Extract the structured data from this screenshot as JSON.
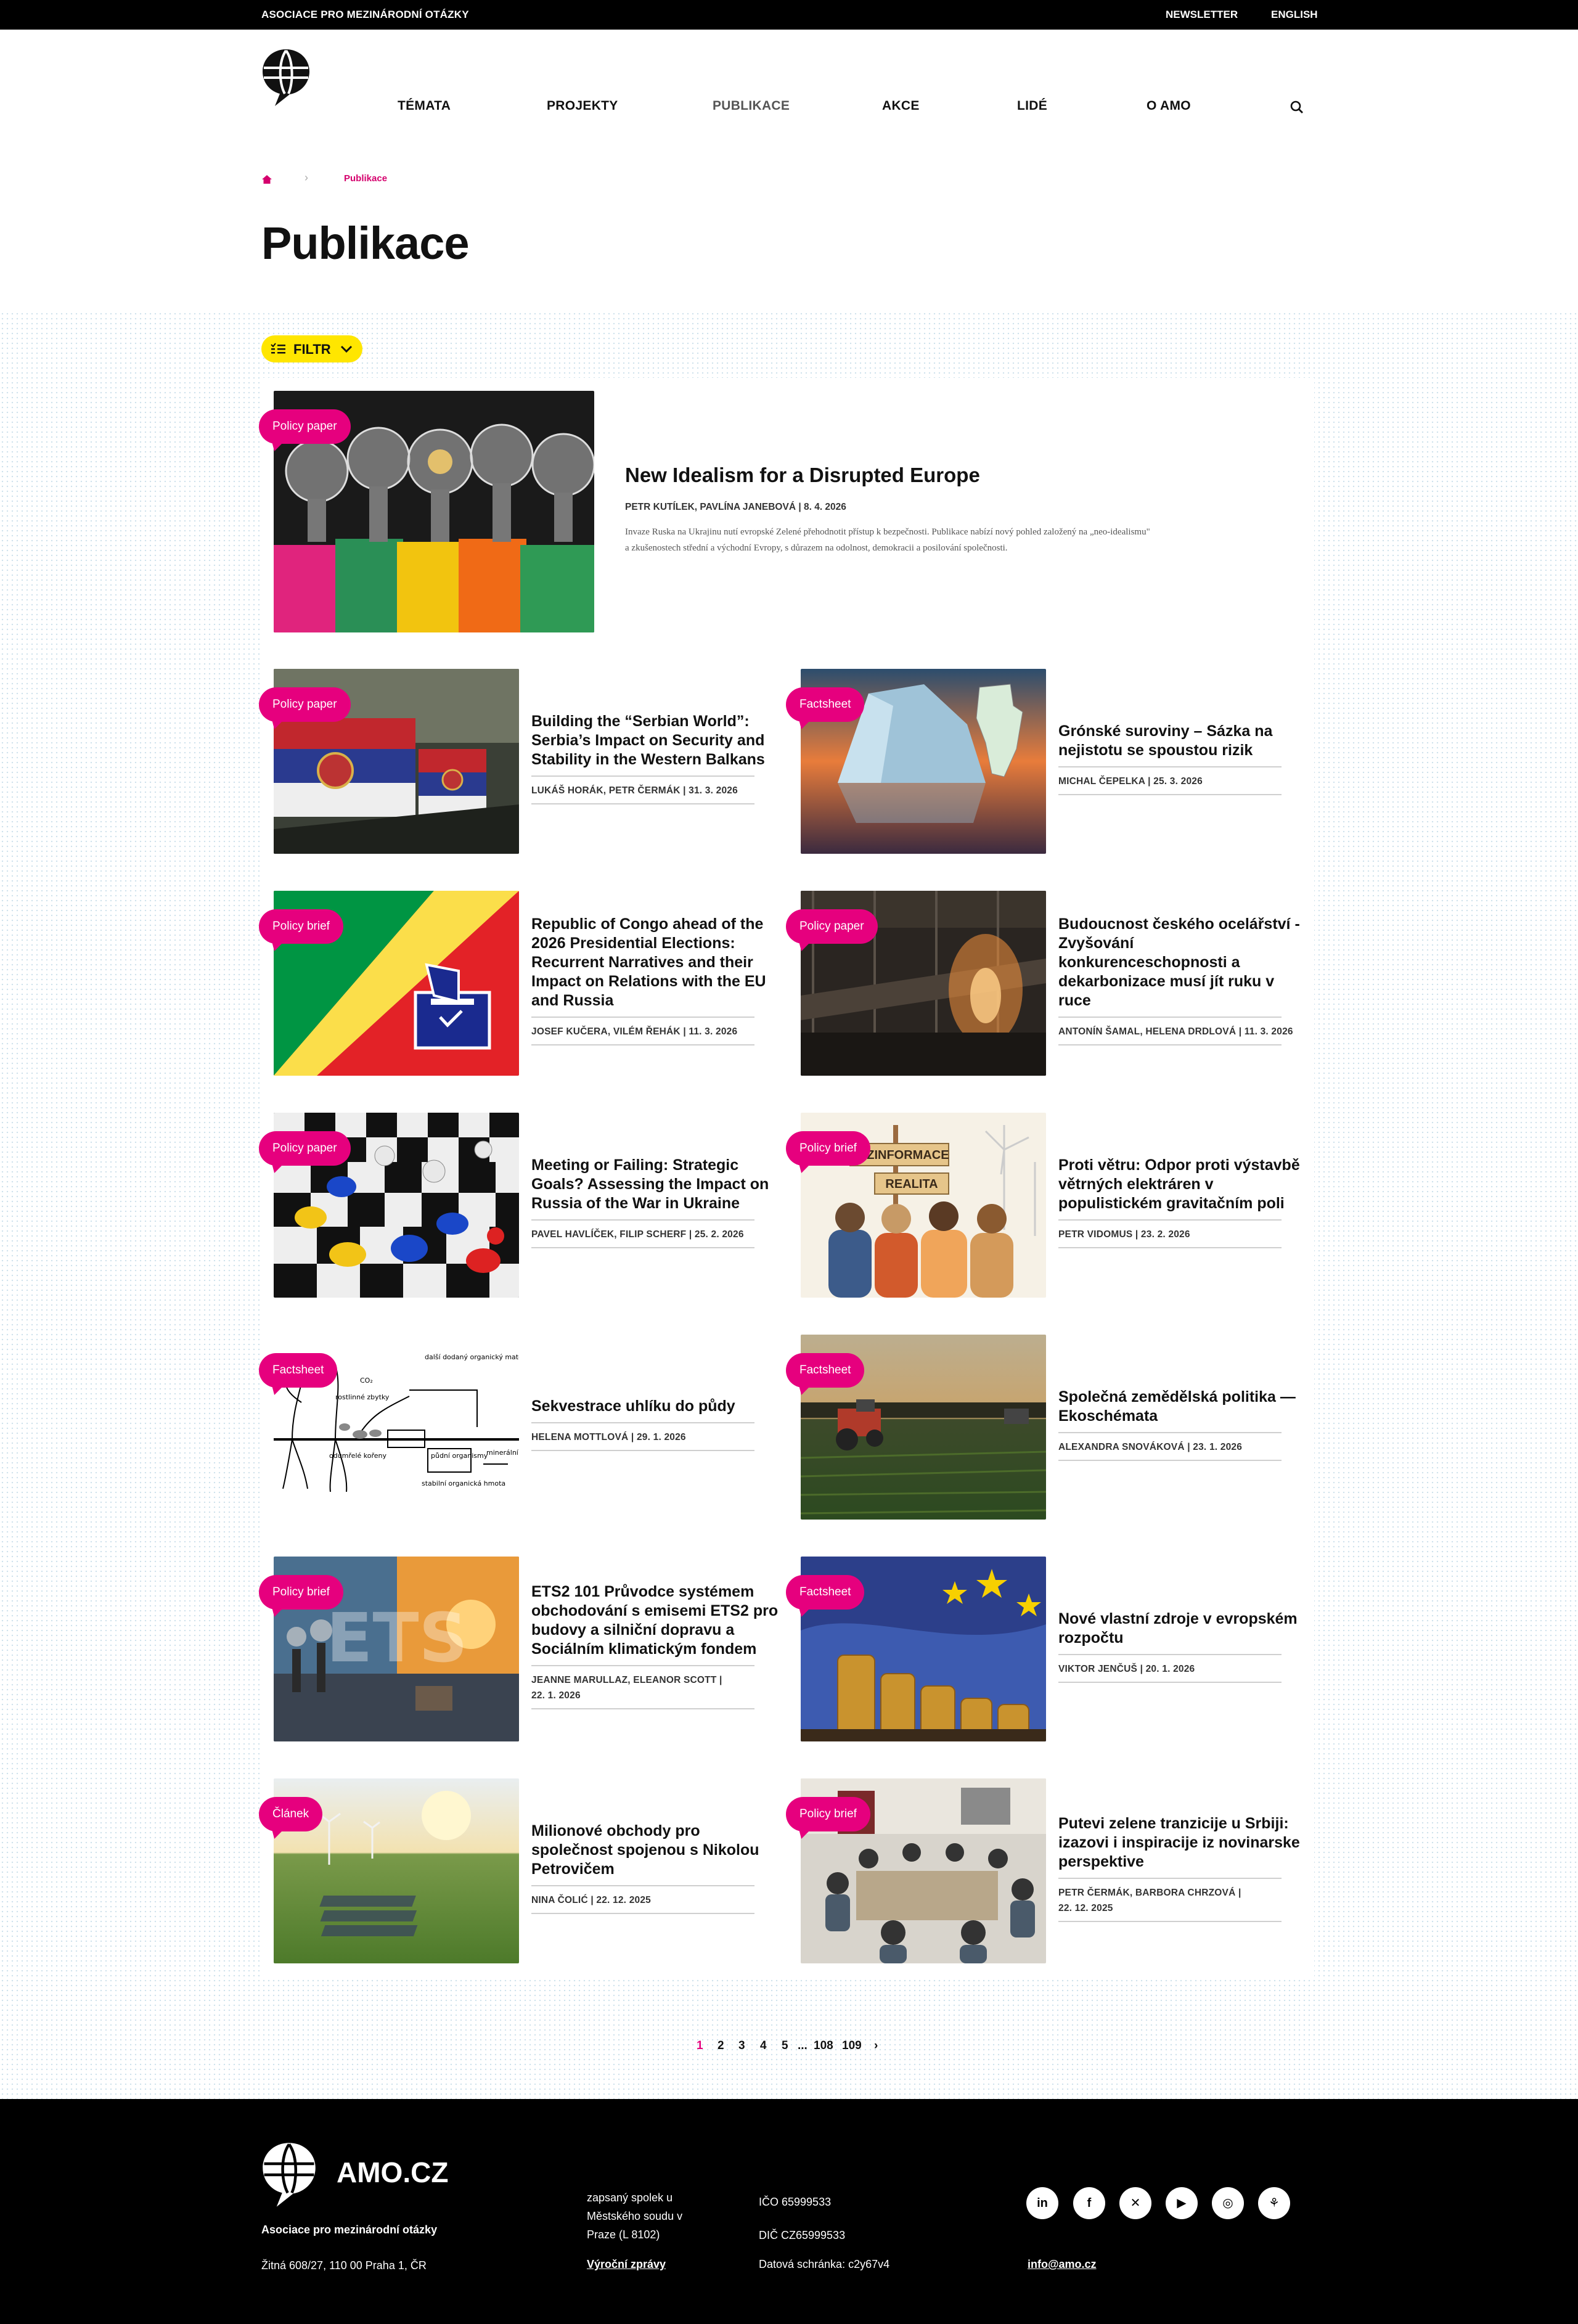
{
  "topbar": {
    "org": "ASOCIACE PRO MEZINÁRODNÍ OTÁZKY",
    "newsletter": "NEWSLETTER",
    "english": "ENGLISH"
  },
  "nav": {
    "items": [
      "TÉMATA",
      "PROJEKTY",
      "PUBLIKACE",
      "AKCE",
      "LIDÉ",
      "O AMO"
    ],
    "active": "PUBLIKACE",
    "search_icon": "search-icon"
  },
  "breadcrumb": {
    "home_icon": "home-icon",
    "current": "Publikace"
  },
  "page_title": "Publikace",
  "filter": {
    "label": "FILTR",
    "icon": "filter-list-icon",
    "chevron": "chevron-down-icon"
  },
  "featured": {
    "tag": "Policy paper",
    "title": "New Idealism for a Disrupted Europe",
    "meta": "PETR KUTÍLEK, PAVLÍNA JANEBOVÁ | 8. 4. 2026",
    "excerpt_1": "Invaze Ruska na Ukrajinu nutí evropské Zelené přehodnotit přístup k bezpečnosti. Publikace nabízí nový pohled založený na „neo-idealismu\"",
    "excerpt_2": "a zkušenostech střední a východní Evropy, s důrazem na odolnost, demokracii a posilování společnosti."
  },
  "cards": [
    {
      "tag": "Policy paper",
      "title_lines": [
        "Building the “Serbian World”:",
        "Serbia’s Impact on Security and",
        "Stability in the Western Balkans"
      ],
      "meta_lines": [
        "LUKÁŠ HORÁK, PETR ČERMÁK | 31. 3. 2026"
      ]
    },
    {
      "tag": "Factsheet",
      "title_lines": [
        "Grónské suroviny – Sázka na",
        "nejistotu se spoustou rizik"
      ],
      "meta_lines": [
        "MICHAL ČEPELKA | 25. 3. 2026"
      ]
    },
    {
      "tag": "Policy brief",
      "title_lines": [
        "Republic of Congo ahead of the",
        "2026 Presidential Elections:",
        "Recurrent Narratives and their",
        "Impact on Relations with the EU",
        "and Russia"
      ],
      "meta_lines": [
        "JOSEF KUČERA, VILÉM ŘEHÁK | 11. 3. 2026"
      ]
    },
    {
      "tag": "Policy paper",
      "title_lines": [
        "Budoucnost českého ocelářství -",
        "Zvyšování",
        "konkurenceschopnosti a",
        "dekarbonizace musí jít ruku v",
        "ruce"
      ],
      "meta_lines": [
        "ANTONÍN ŠAMAL, HELENA DRDLOVÁ | 11. 3. 2026"
      ]
    },
    {
      "tag": "Policy paper",
      "title_lines": [
        "Meeting or Failing: Strategic",
        "Goals? Assessing the Impact on",
        "Russia of the War in Ukraine"
      ],
      "meta_lines": [
        "PAVEL HAVLÍČEK, FILIP SCHERF | 25. 2. 2026"
      ]
    },
    {
      "tag": "Policy brief",
      "title_lines": [
        "Proti větru: Odpor proti výstavbě",
        "větrných elektráren v",
        "populistickém gravitačním poli"
      ],
      "meta_lines": [
        "PETR VIDOMUS | 23. 2. 2026"
      ]
    },
    {
      "tag": "Factsheet",
      "title_lines": [
        "Sekvestrace uhlíku do půdy"
      ],
      "meta_lines": [
        "HELENA MOTTLOVÁ | 29. 1. 2026"
      ]
    },
    {
      "tag": "Factsheet",
      "title_lines": [
        "Společná zemědělská politika —",
        "Ekoschémata"
      ],
      "meta_lines": [
        "ALEXANDRA SNOVÁKOVÁ | 23. 1. 2026"
      ]
    },
    {
      "tag": "Policy brief",
      "title_lines": [
        "ETS2 101 Průvodce systémem",
        "obchodování s emisemi ETS2 pro",
        "budovy a silniční dopravu a",
        "Sociálním klimatickým fondem"
      ],
      "meta_lines": [
        "JEANNE MARULLAZ, ELEANOR SCOTT |",
        "22. 1. 2026"
      ]
    },
    {
      "tag": "Factsheet",
      "title_lines": [
        "Nové vlastní zdroje v evropském",
        "rozpočtu"
      ],
      "meta_lines": [
        "VIKTOR JENČUŠ | 20. 1. 2026"
      ]
    },
    {
      "tag": "Článek",
      "title_lines": [
        "Milionové obchody pro",
        "společnost spojenou s Nikolou",
        "Petrovičem"
      ],
      "meta_lines": [
        "NINA ČOLIĆ | 22. 12. 2025"
      ]
    },
    {
      "tag": "Policy brief",
      "title_lines": [
        "Putevi zelene tranzicije u Srbiji:",
        "izazovi i inspiracije iz novinarske",
        "perspektive"
      ],
      "meta_lines": [
        "PETR ČERMÁK, BARBORA CHRZOVÁ |",
        "22. 12. 2025"
      ]
    }
  ],
  "image_texts": {
    "dezinformace": "DEZINFORMACE",
    "realita": "REALITA",
    "ets": "ETS",
    "co2": "CO₂",
    "soil_1": "rostlinné zbytky",
    "soil_2": "odumřelé kořeny",
    "soil_3": "půdní organismy",
    "soil_4": "další dodaný organický materiál (kompost, hnůj)",
    "soil_5": "stabilní organická hmota",
    "soil_6": "minerální"
  },
  "pagination": {
    "pages": [
      "1",
      "2",
      "3",
      "4",
      "5",
      "...",
      "108",
      "109"
    ],
    "current": "1",
    "next_icon": "chevron-right-icon"
  },
  "footer": {
    "brand": "AMO.CZ",
    "org": "Asociace pro mezinárodní otázky",
    "address": "Žitná 608/27, 110 00 Praha 1, ČR",
    "reg_lines": [
      "zapsaný spolek u",
      "Městského soudu v",
      "Praze (L 8102)"
    ],
    "annual_report": "Výroční zprávy",
    "ico": "IČO 65999533",
    "dic": "DIČ CZ65999533",
    "databox": "Datová schránka: c2y67v4",
    "email": "info@amo.cz",
    "social": [
      "linkedin-icon",
      "facebook-icon",
      "x-icon",
      "youtube-icon",
      "instagram-icon",
      "bluesky-icon"
    ]
  },
  "colors": {
    "accent": "#e6007e",
    "filter": "#ffe600",
    "footer_bg": "#000000"
  }
}
